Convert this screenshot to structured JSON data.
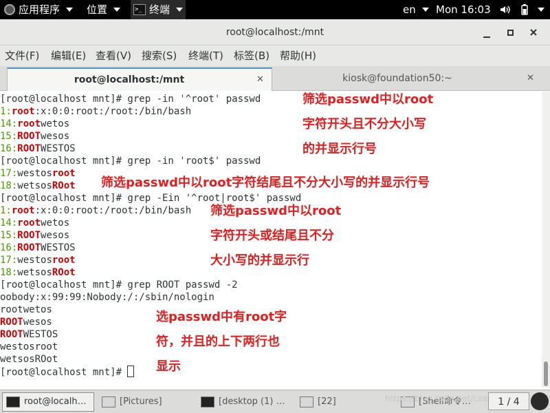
{
  "topbar": {
    "apps_label": "应用程序",
    "places_label": "位置",
    "terminal_label": "终端",
    "terminal_icon_text": ">_",
    "lang": "en",
    "clock": "Mon 16:03"
  },
  "window": {
    "title": "root@localhost:/mnt"
  },
  "menubar": {
    "items": [
      "文件(F)",
      "编辑(E)",
      "查看(V)",
      "搜索(S)",
      "终端(T)",
      "标签(B)",
      "帮助(H)"
    ]
  },
  "tabs": [
    {
      "label": "root@localhost:/mnt",
      "active": true
    },
    {
      "label": "kiosk@foundation50:~",
      "active": false
    }
  ],
  "terminal": {
    "lines": [
      [
        {
          "t": "[root@localhost mnt]# grep -in '^root' passwd"
        }
      ],
      [
        {
          "t": "1:",
          "c": "grn"
        },
        {
          "t": "root",
          "c": "red"
        },
        {
          "t": ":x:0:0:root:/root:/bin/bash"
        }
      ],
      [
        {
          "t": "14:",
          "c": "grn"
        },
        {
          "t": "root",
          "c": "red"
        },
        {
          "t": "wetos"
        }
      ],
      [
        {
          "t": "15:",
          "c": "grn"
        },
        {
          "t": "ROOT",
          "c": "red"
        },
        {
          "t": "wesos"
        }
      ],
      [
        {
          "t": "16:",
          "c": "grn"
        },
        {
          "t": "ROOT",
          "c": "red"
        },
        {
          "t": "WESTOS"
        }
      ],
      [
        {
          "t": "[root@localhost mnt]# grep -in 'root$' passwd"
        }
      ],
      [
        {
          "t": "17:",
          "c": "grn"
        },
        {
          "t": "westos"
        },
        {
          "t": "root",
          "c": "red"
        }
      ],
      [
        {
          "t": "18:",
          "c": "grn"
        },
        {
          "t": "wetsos"
        },
        {
          "t": "ROot",
          "c": "red"
        }
      ],
      [
        {
          "t": "[root@localhost mnt]# grep -Ein '^root|root$' passwd"
        }
      ],
      [
        {
          "t": "1:",
          "c": "grn"
        },
        {
          "t": "root",
          "c": "red"
        },
        {
          "t": ":x:0:0:root:/root:/bin/bash"
        }
      ],
      [
        {
          "t": "14:",
          "c": "grn"
        },
        {
          "t": "root",
          "c": "red"
        },
        {
          "t": "wetos"
        }
      ],
      [
        {
          "t": "15:",
          "c": "grn"
        },
        {
          "t": "ROOT",
          "c": "red"
        },
        {
          "t": "wesos"
        }
      ],
      [
        {
          "t": "16:",
          "c": "grn"
        },
        {
          "t": "ROOT",
          "c": "red"
        },
        {
          "t": "WESTOS"
        }
      ],
      [
        {
          "t": "17:",
          "c": "grn"
        },
        {
          "t": "westos"
        },
        {
          "t": "root",
          "c": "red"
        }
      ],
      [
        {
          "t": "18:",
          "c": "grn"
        },
        {
          "t": "wetsos"
        },
        {
          "t": "ROot",
          "c": "red"
        }
      ],
      [
        {
          "t": "[root@localhost mnt]# grep ROOT passwd -2"
        }
      ],
      [
        {
          "t": "oobody:x:99:99:Nobody:/:/sbin/nologin"
        }
      ],
      [
        {
          "t": "rootwetos"
        }
      ],
      [
        {
          "t": "ROOT",
          "c": "red"
        },
        {
          "t": "wesos"
        }
      ],
      [
        {
          "t": "ROOT",
          "c": "red"
        },
        {
          "t": "WESTOS"
        }
      ],
      [
        {
          "t": "westosroot"
        }
      ],
      [
        {
          "t": "wetsosROot"
        }
      ],
      [
        {
          "t": "[root@localhost mnt]# "
        }
      ]
    ]
  },
  "annotations": [
    {
      "lines": [
        "筛选passwd中以root",
        "字符开头且不分大小写",
        "的并显示行号"
      ]
    },
    {
      "lines": [
        "筛选passwd中以root字符结尾且不分大小写的并显示行号"
      ]
    },
    {
      "lines": [
        "筛选passwd中以root",
        "字符开头或结尾且不分",
        "大小写的并显示行"
      ]
    },
    {
      "lines": [
        "选passwd中有root字",
        "符，并且的上下两行也",
        "显示"
      ]
    }
  ],
  "taskbar": {
    "items": [
      "root@localh…",
      "[Pictures]",
      "[desktop (1) …",
      "[22]",
      "[Shell命令…"
    ],
    "watermark": "https://blog.csdn.net/Lash1_qis",
    "pager": "1 / 4"
  },
  "colors": {
    "prompt_text": "#2e3436",
    "match_red": "#cc0000",
    "line_number_green": "#4e9a06",
    "annotation_red": "#e02020"
  }
}
